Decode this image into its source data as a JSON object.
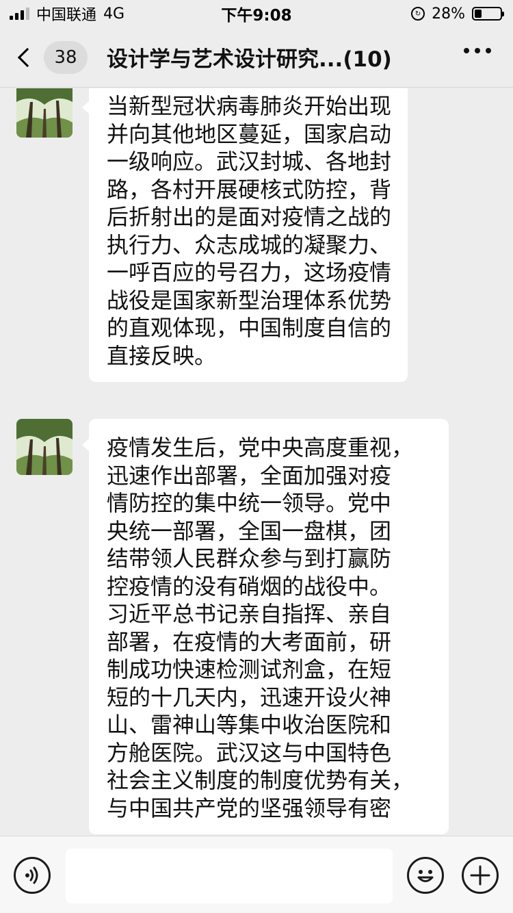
{
  "status_bar": {
    "carrier": "中国联通",
    "network": "4G",
    "time": "下午9:08",
    "battery": "28%",
    "battery_level": 0.28
  },
  "nav": {
    "unread_count": "38",
    "title": "设计学与艺术设计研究...",
    "member_count": "(10)"
  },
  "messages": [
    {
      "lines": [
        "当新型冠状病毒肺炎开始出现",
        "并向其他地区蔓延，国家启动",
        "一级响应。武汉封城、各地封",
        "路，各村开展硬核式防控，背",
        "后折射出的是面对疫情之战的",
        "执行力、众志成城的凝聚力、",
        "一呼百应的号召力，这场疫情",
        "战役是国家新型治理体系优势",
        "的直观体现，中国制度自信的",
        "直接反映。"
      ]
    },
    {
      "lines": [
        "疫情发生后，党中央高度重视，",
        "迅速作出部署，全面加强对疫",
        "情防控的集中统一领导。党中",
        "央统一部署，全国一盘棋，团",
        "结带领人民群众参与到打赢防",
        "控疫情的没有硝烟的战役中。",
        "习近平总书记亲自指挥、亲自",
        "部署，在疫情的大考面前，研",
        "制成功快速检测试剂盒，在短",
        "短的十几天内，迅速开设火神",
        "山、雷神山等集中收治医院和",
        "方舱医院。武汉这与中国特色",
        "社会主义制度的制度优势有关，",
        "与中国共产党的坚强领导有密"
      ]
    }
  ],
  "icons": {
    "back": "chevron-left-icon",
    "more": "ellipsis-icon",
    "voice": "voice-icon",
    "emoji": "smiley-icon",
    "plus": "plus-icon"
  }
}
